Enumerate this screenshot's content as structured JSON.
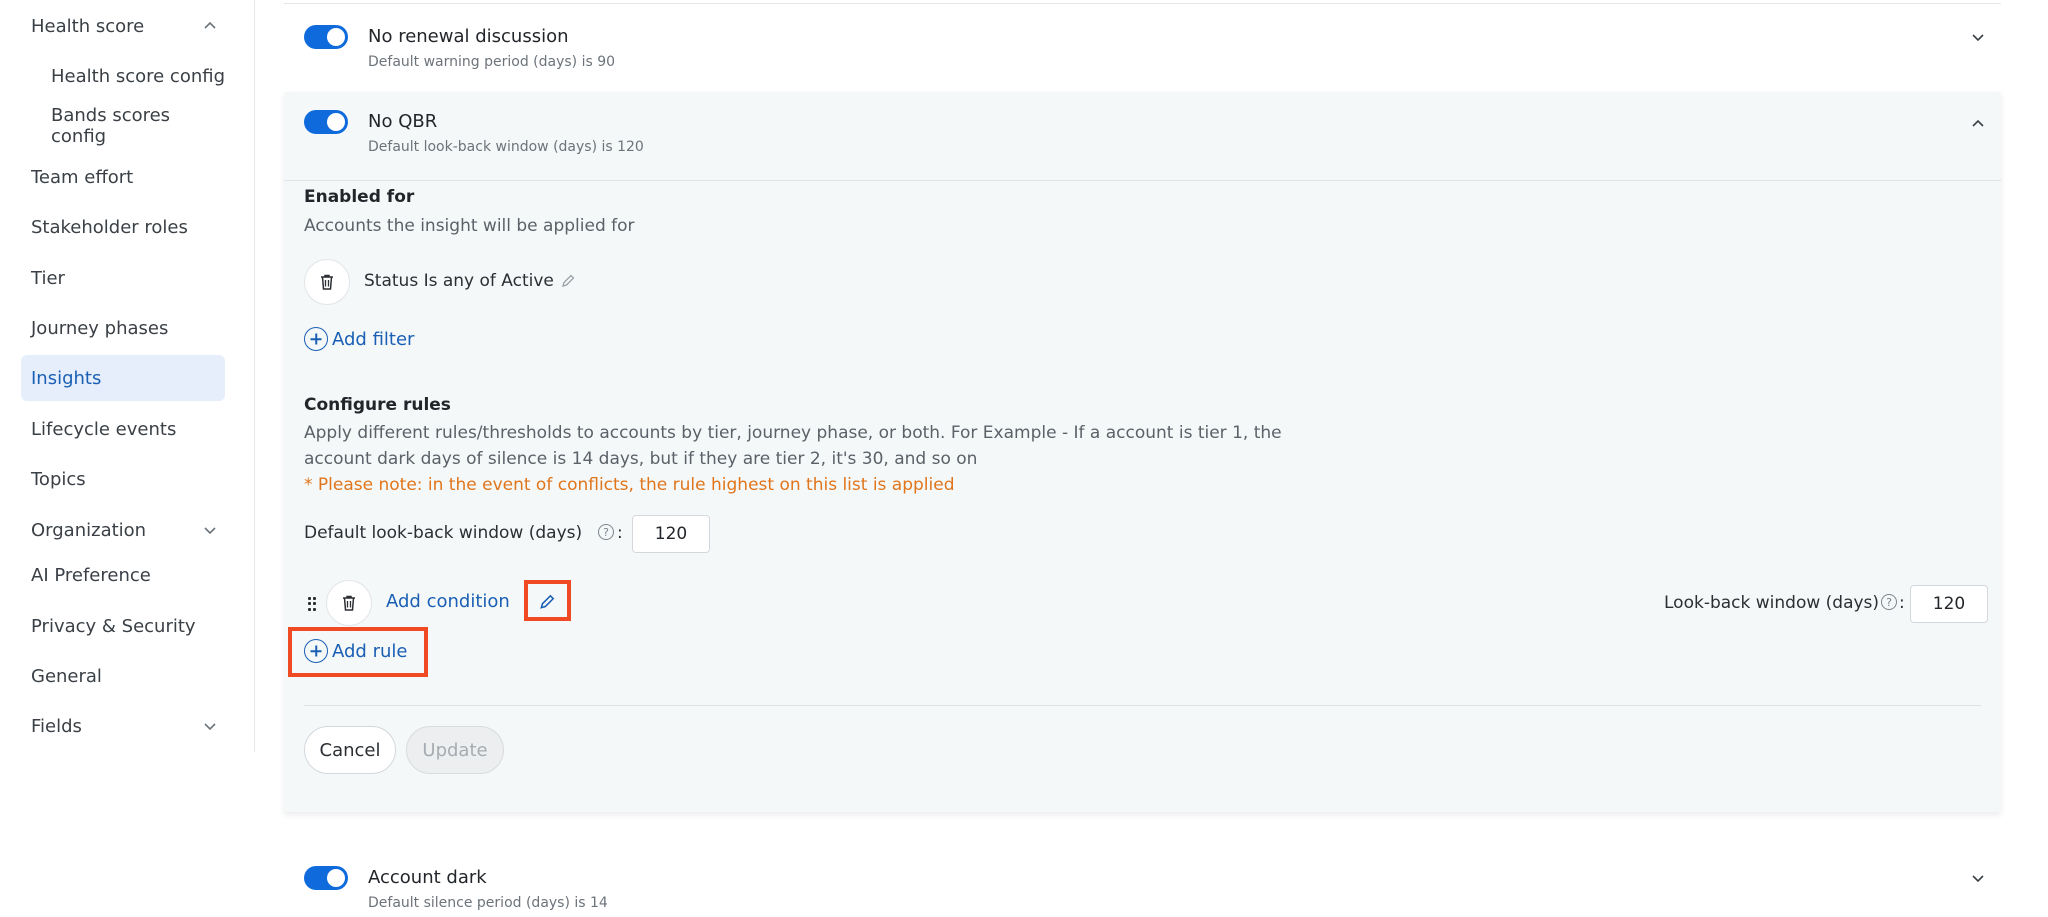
{
  "sidebar": {
    "items": [
      {
        "label": "Health score",
        "expanded": true
      },
      {
        "label": "Health score config"
      },
      {
        "label": "Bands scores config"
      },
      {
        "label": "Team effort"
      },
      {
        "label": "Stakeholder roles"
      },
      {
        "label": "Tier"
      },
      {
        "label": "Journey phases"
      },
      {
        "label": "Insights",
        "active": true
      },
      {
        "label": "Lifecycle events"
      },
      {
        "label": "Topics"
      },
      {
        "label": "Organization",
        "expanded": false
      },
      {
        "label": "AI Preference"
      },
      {
        "label": "Privacy & Security"
      },
      {
        "label": "General"
      },
      {
        "label": "Fields",
        "expanded": false
      }
    ]
  },
  "insights": {
    "no_renewal": {
      "title": "No renewal discussion",
      "subtitle": "Default warning period (days) is 90",
      "enabled": true
    },
    "no_qbr": {
      "title": "No QBR",
      "subtitle": "Default look-back window (days) is 120",
      "enabled": true
    },
    "account_dark": {
      "title": "Account dark",
      "subtitle": "Default silence period (days) is 14",
      "enabled": true
    }
  },
  "enabled_for": {
    "title": "Enabled for",
    "description": "Accounts the insight will be applied for",
    "filter_text": "Status Is any of Active",
    "add_filter_label": "Add filter"
  },
  "configure_rules": {
    "title": "Configure rules",
    "description_line1": "Apply different rules/thresholds to accounts by tier, journey phase, or both. For Example - If a account is tier 1, the",
    "description_line2": "account dark days of silence is 14 days, but if they are tier 2, it's 30, and so on",
    "note": "* Please note: in the event of conflicts, the rule highest on this list is applied",
    "default_label": "Default look-back window (days)",
    "default_value": "120",
    "rule": {
      "add_condition_label": "Add condition",
      "lookback_label": "Look-back window (days)",
      "lookback_value": "120"
    },
    "add_rule_label": "Add rule"
  },
  "actions": {
    "cancel_label": "Cancel",
    "update_label": "Update"
  },
  "colors": {
    "accent": "#0f6bdc",
    "link": "#1a5fb4",
    "warning": "#e0751b",
    "highlight": "#ef4a23",
    "active_nav_bg": "#e6eefb"
  }
}
